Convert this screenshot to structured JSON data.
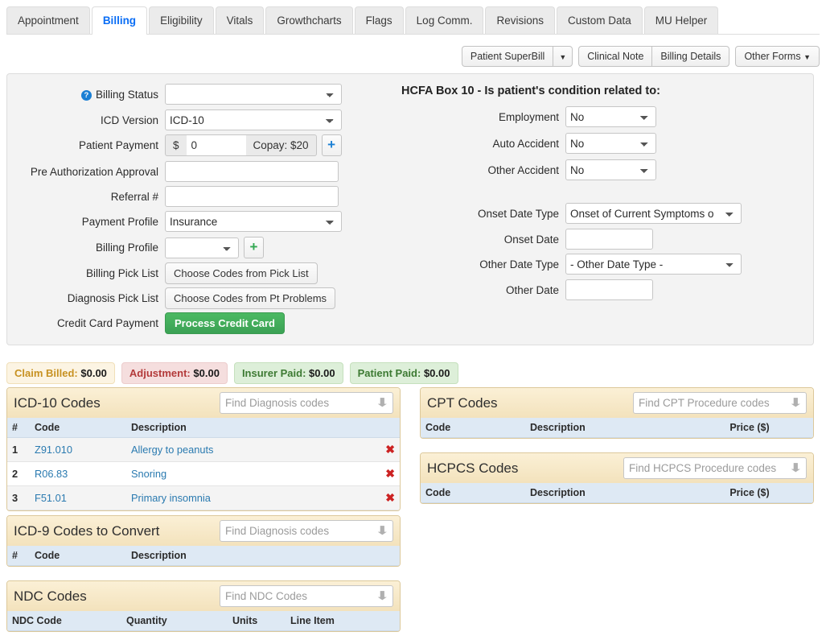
{
  "tabs": [
    {
      "label": "Appointment",
      "active": false
    },
    {
      "label": "Billing",
      "active": true
    },
    {
      "label": "Eligibility",
      "active": false
    },
    {
      "label": "Vitals",
      "active": false
    },
    {
      "label": "Growthcharts",
      "active": false
    },
    {
      "label": "Flags",
      "active": false
    },
    {
      "label": "Log Comm.",
      "active": false
    },
    {
      "label": "Revisions",
      "active": false
    },
    {
      "label": "Custom Data",
      "active": false
    },
    {
      "label": "MU Helper",
      "active": false
    }
  ],
  "toolbar": {
    "superbill_label": "Patient SuperBill",
    "superbill_caret": "▼",
    "clinical_note_label": "Clinical Note",
    "billing_details_label": "Billing Details",
    "other_forms_label": "Other Forms",
    "other_forms_caret": "▼"
  },
  "form": {
    "billing_status": {
      "label": "Billing Status",
      "value": "",
      "help_icon": "?"
    },
    "icd_version": {
      "label": "ICD Version",
      "value": "ICD-10"
    },
    "patient_payment": {
      "label": "Patient Payment",
      "currency": "$",
      "value": "0",
      "copay": "Copay: $20",
      "add": "+"
    },
    "pre_auth": {
      "label": "Pre Authorization Approval",
      "value": ""
    },
    "referral": {
      "label": "Referral #",
      "value": ""
    },
    "payment_profile": {
      "label": "Payment Profile",
      "value": "Insurance"
    },
    "billing_profile": {
      "label": "Billing Profile",
      "value": "",
      "add": "+"
    },
    "billing_pick_list": {
      "label": "Billing Pick List",
      "button": "Choose Codes from Pick List"
    },
    "diagnosis_pick_list": {
      "label": "Diagnosis Pick List",
      "button": "Choose Codes from Pt Problems"
    },
    "credit_card": {
      "label": "Credit Card Payment",
      "button": "Process Credit Card"
    }
  },
  "hcfa": {
    "title": "HCFA Box 10 - Is patient's condition related to:",
    "employment": {
      "label": "Employment",
      "value": "No"
    },
    "auto_accident": {
      "label": "Auto Accident",
      "value": "No"
    },
    "other_accident": {
      "label": "Other Accident",
      "value": "No"
    },
    "onset_date_type": {
      "label": "Onset Date Type",
      "value": "Onset of Current Symptoms o"
    },
    "onset_date": {
      "label": "Onset Date",
      "value": ""
    },
    "other_date_type": {
      "label": "Other Date Type",
      "value": "- Other Date Type -"
    },
    "other_date": {
      "label": "Other Date",
      "value": ""
    }
  },
  "badges": [
    {
      "label": "Claim Billed:",
      "amount": "$0.00"
    },
    {
      "label": "Adjustment:",
      "amount": "$0.00"
    },
    {
      "label": "Insurer Paid:",
      "amount": "$0.00"
    },
    {
      "label": "Patient Paid:",
      "amount": "$0.00"
    }
  ],
  "icd10_panel": {
    "title": "ICD-10 Codes",
    "find_placeholder": "Find Diagnosis codes",
    "columns": [
      "#",
      "Code",
      "Description"
    ],
    "rows": [
      {
        "num": "1",
        "code": "Z91.010",
        "description": "Allergy to peanuts",
        "delete": "✖"
      },
      {
        "num": "2",
        "code": "R06.83",
        "description": "Snoring",
        "delete": "✖"
      },
      {
        "num": "3",
        "code": "F51.01",
        "description": "Primary insomnia",
        "delete": "✖"
      }
    ]
  },
  "icd9_panel": {
    "title": "ICD-9 Codes to Convert",
    "find_placeholder": "Find Diagnosis codes",
    "columns": [
      "#",
      "Code",
      "Description"
    ],
    "rows": []
  },
  "ndc_panel": {
    "title": "NDC Codes",
    "find_placeholder": "Find NDC Codes",
    "columns": [
      "NDC Code",
      "Quantity",
      "Units",
      "Line Item"
    ],
    "rows": []
  },
  "cpt_panel": {
    "title": "CPT Codes",
    "find_placeholder": "Find CPT Procedure codes",
    "columns": [
      "Code",
      "Description",
      "Price ($)"
    ],
    "rows": []
  },
  "hcpcs_panel": {
    "title": "HCPCS Codes",
    "find_placeholder": "Find HCPCS Procedure codes",
    "columns": [
      "Code",
      "Description",
      "Price ($)"
    ],
    "rows": []
  },
  "icons": {
    "down_arrow": "⬇",
    "plus": "+",
    "x": "✖"
  },
  "colors": {
    "active_tab_text": "#0b6ef5",
    "panel_header": "#f3e2bc",
    "table_header": "#dee9f4",
    "green_button": "#3ba154",
    "link": "#2a7ab0",
    "delete": "#cc2222"
  }
}
